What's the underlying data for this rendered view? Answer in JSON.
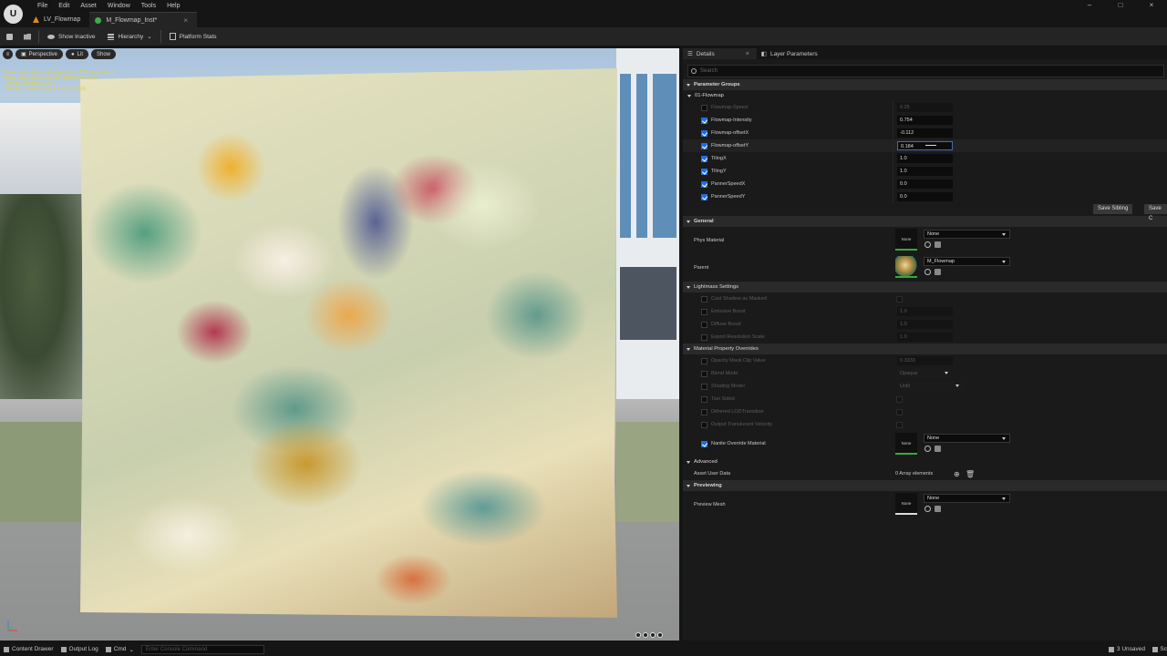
{
  "menu": [
    "File",
    "Edit",
    "Asset",
    "Window",
    "Tools",
    "Help"
  ],
  "tabs": [
    {
      "label": "LV_Flowmap",
      "active": false
    },
    {
      "label": "M_Flowmap_Inst*",
      "active": true
    }
  ],
  "toolbar": {
    "show_inactive": "Show Inactive",
    "hierarchy": "Hierarchy",
    "platform_stats": "Platform Stats"
  },
  "viewport": {
    "perspective": "Perspective",
    "lit": "Lit",
    "show": "Show",
    "stats": [
      "Base pass shader with light map: 121 instructions",
      "Base pass vertex shader: 250 instructions",
      "Texture samplers: 3/16",
      "Texture Lookups (Est.): VS(0), PS(4)"
    ]
  },
  "details": {
    "tab_details": "Details",
    "tab_layer_params": "Layer Parameters",
    "search_placeholder": "Search",
    "parameter_groups": "Parameter Groups",
    "group_flowmap": "01-Flowmap",
    "params": [
      {
        "label": "Flowmap-Speed",
        "value": "0.25",
        "enabled": false
      },
      {
        "label": "Flowmap-Intensity",
        "value": "0.754",
        "enabled": true
      },
      {
        "label": "Flowmap-offsetX",
        "value": "-0.112",
        "enabled": true
      },
      {
        "label": "Flowmap-offsetY",
        "value": "0.184",
        "enabled": true
      },
      {
        "label": "TilingX",
        "value": "1.0",
        "enabled": true
      },
      {
        "label": "TilingY",
        "value": "1.0",
        "enabled": true
      },
      {
        "label": "PannerSpeedX",
        "value": "0.0",
        "enabled": true
      },
      {
        "label": "PannerSpeedY",
        "value": "0.0",
        "enabled": true
      }
    ],
    "save_sibling": "Save Sibling",
    "save_child": "Save C",
    "general": "General",
    "phys_material": "Phys Material",
    "phys_value": "None",
    "phys_thumb": "None",
    "parent": "Parent",
    "parent_value": "M_Flowmap",
    "lightmass": "Lightmass Settings",
    "lightmass_rows": [
      {
        "label": "Cast Shadow as Masked",
        "value": ""
      },
      {
        "label": "Emissive Boost",
        "value": "1.0"
      },
      {
        "label": "Diffuse Boost",
        "value": "1.0"
      },
      {
        "label": "Export Resolution Scale",
        "value": "1.0"
      }
    ],
    "mpo": "Material Property Overrides",
    "opacity_label": "Opacity Mask Clip Value",
    "opacity_value": "0.3333",
    "blend_label": "Blend Mode",
    "blend_value": "Opaque",
    "shading_label": "Shading Model",
    "shading_value": "Unlit",
    "two_sided": "Two Sided",
    "dithered": "Dithered LODTransition",
    "translucent": "Output Translucent Velocity",
    "nanite_label": "Nanite Override Material",
    "nanite_value": "None",
    "nanite_thumb": "None",
    "advanced": "Advanced",
    "asset_user_data": "Asset User Data",
    "array_elements": "0 Array elements",
    "previewing": "Previewing",
    "preview_mesh": "Preview Mesh",
    "preview_value": "None",
    "preview_thumb": "None"
  },
  "statusbar": {
    "content_drawer": "Content Drawer",
    "output_log": "Output Log",
    "cmd": "Cmd",
    "console_placeholder": "Enter Console Command",
    "unsaved": "3 Unsaved",
    "sc": "Sc"
  },
  "colors": {
    "accent": "#1f6ee0",
    "asset_border": "#39a83d",
    "stats_text": "#e6d23a"
  }
}
